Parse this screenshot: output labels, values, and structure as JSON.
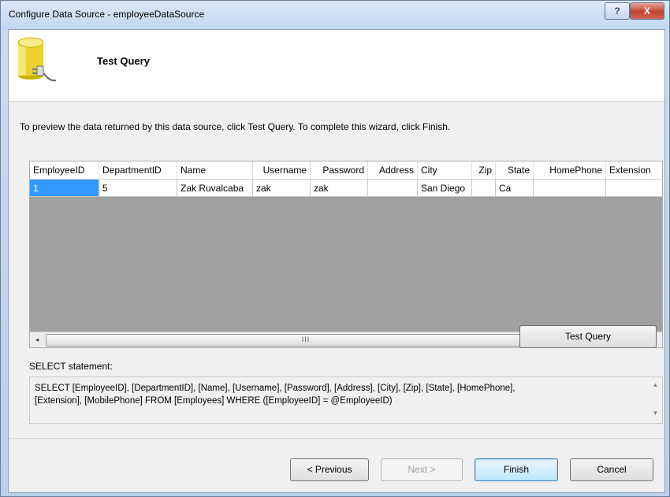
{
  "window": {
    "title": "Configure Data Source - employeeDataSource",
    "help_label": "?",
    "close_label": "X"
  },
  "header": {
    "title": "Test Query",
    "icon": "database-plug-icon"
  },
  "instruction": "To preview the data returned by this data source, click Test Query. To complete this wizard, click Finish.",
  "grid": {
    "columns": [
      "EmployeeID",
      "DepartmentID",
      "Name",
      "Username",
      "Password",
      "Address",
      "City",
      "Zip",
      "State",
      "HomePhone",
      "Extension"
    ],
    "rows": [
      [
        "1",
        "5",
        "Zak Ruvalcaba",
        "zak",
        "zak",
        "",
        "San Diego",
        "",
        "Ca",
        "",
        ""
      ]
    ],
    "scroll_left": "◂",
    "scroll_right": "▸",
    "scroll_thumb": "III"
  },
  "test_query_button": "Test Query",
  "select_label": "SELECT statement:",
  "sql_lines": [
    "SELECT [EmployeeID], [DepartmentID], [Name], [Username], [Password], [Address], [City], [Zip], [State], [HomePhone],",
    "[Extension], [MobilePhone] FROM [Employees] WHERE ([EmployeeID] = @EmployeeID)"
  ],
  "sql_scroll_up": "▲",
  "sql_scroll_down": "▼",
  "buttons": {
    "previous": "< Previous",
    "next": "Next >",
    "finish": "Finish",
    "cancel": "Cancel"
  },
  "colors": {
    "selection": "#3399ff",
    "grid_background": "#a0a0a0",
    "titlebar": "#c3d7f0"
  }
}
